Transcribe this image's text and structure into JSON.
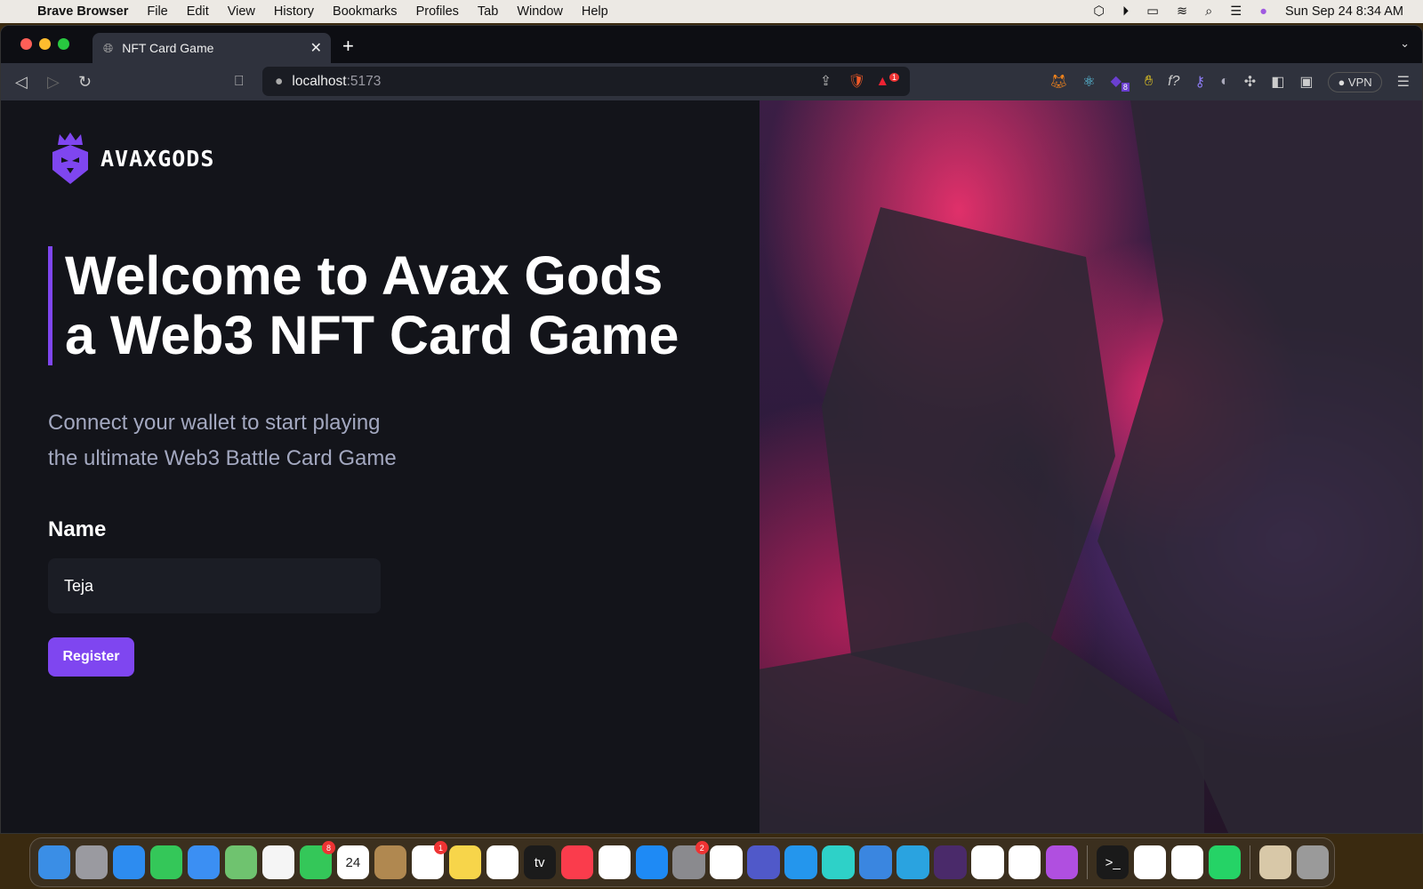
{
  "menubar": {
    "app": "Brave Browser",
    "items": [
      "File",
      "Edit",
      "View",
      "History",
      "Bookmarks",
      "Profiles",
      "Tab",
      "Window",
      "Help"
    ],
    "clock": "Sun Sep 24  8:34 AM"
  },
  "browser": {
    "tab_title": "NFT Card Game",
    "url_host": "localhost",
    "url_port": ":5173",
    "rewards_badge": "1",
    "ext_badge": "8",
    "vpn_label": "VPN"
  },
  "page": {
    "logo_text": "AVAXGODS",
    "heading_line1": "Welcome to Avax Gods",
    "heading_line2": "a Web3 NFT Card Game",
    "subtitle_line1": "Connect your wallet to start playing",
    "subtitle_line2": "the ultimate Web3 Battle Card Game",
    "name_label": "Name",
    "name_value": "Teja",
    "register_label": "Register",
    "accent": "#7f46f0"
  },
  "dock": {
    "items": [
      {
        "name": "finder",
        "color": "#3a8ee6"
      },
      {
        "name": "launchpad",
        "color": "#9a9aa0"
      },
      {
        "name": "safari",
        "color": "#2d8cf0"
      },
      {
        "name": "messages",
        "color": "#34c759"
      },
      {
        "name": "mail",
        "color": "#3b8ff3"
      },
      {
        "name": "maps",
        "color": "#6fc36f"
      },
      {
        "name": "photos",
        "color": "#f5f5f5"
      },
      {
        "name": "facetime",
        "color": "#34c759",
        "badge": "8"
      },
      {
        "name": "calendar",
        "color": "#ffffff",
        "text": "24"
      },
      {
        "name": "contacts",
        "color": "#b08850"
      },
      {
        "name": "reminders",
        "color": "#ffffff",
        "badge": "1"
      },
      {
        "name": "notes",
        "color": "#f7d54a"
      },
      {
        "name": "freeform",
        "color": "#ffffff"
      },
      {
        "name": "tv",
        "color": "#1b1b1b",
        "text": "tv"
      },
      {
        "name": "music",
        "color": "#fa3c4c"
      },
      {
        "name": "news",
        "color": "#ffffff"
      },
      {
        "name": "app-store",
        "color": "#1e8af5"
      },
      {
        "name": "system-settings",
        "color": "#8a8a8e",
        "badge": "2"
      },
      {
        "name": "ticktick",
        "color": "#ffffff"
      },
      {
        "name": "teams",
        "color": "#5059c9"
      },
      {
        "name": "docker",
        "color": "#2496ed"
      },
      {
        "name": "cube-app",
        "color": "#2ed1c8"
      },
      {
        "name": "weather",
        "color": "#3a86e0"
      },
      {
        "name": "telegram",
        "color": "#2aa3e0"
      },
      {
        "name": "alfred",
        "color": "#4a2a6a"
      },
      {
        "name": "chrome",
        "color": "#ffffff"
      },
      {
        "name": "edge",
        "color": "#ffffff"
      },
      {
        "name": "feedback",
        "color": "#b04fe0"
      },
      {
        "sep": true
      },
      {
        "name": "terminal",
        "color": "#1a1a1a",
        "text": ">_"
      },
      {
        "name": "brave",
        "color": "#ffffff"
      },
      {
        "name": "vscode",
        "color": "#ffffff"
      },
      {
        "name": "whatsapp",
        "color": "#25d366"
      },
      {
        "sep": true
      },
      {
        "name": "photo-stack",
        "color": "#d8c8a8"
      },
      {
        "name": "trash",
        "color": "#9a9a9a"
      }
    ]
  }
}
